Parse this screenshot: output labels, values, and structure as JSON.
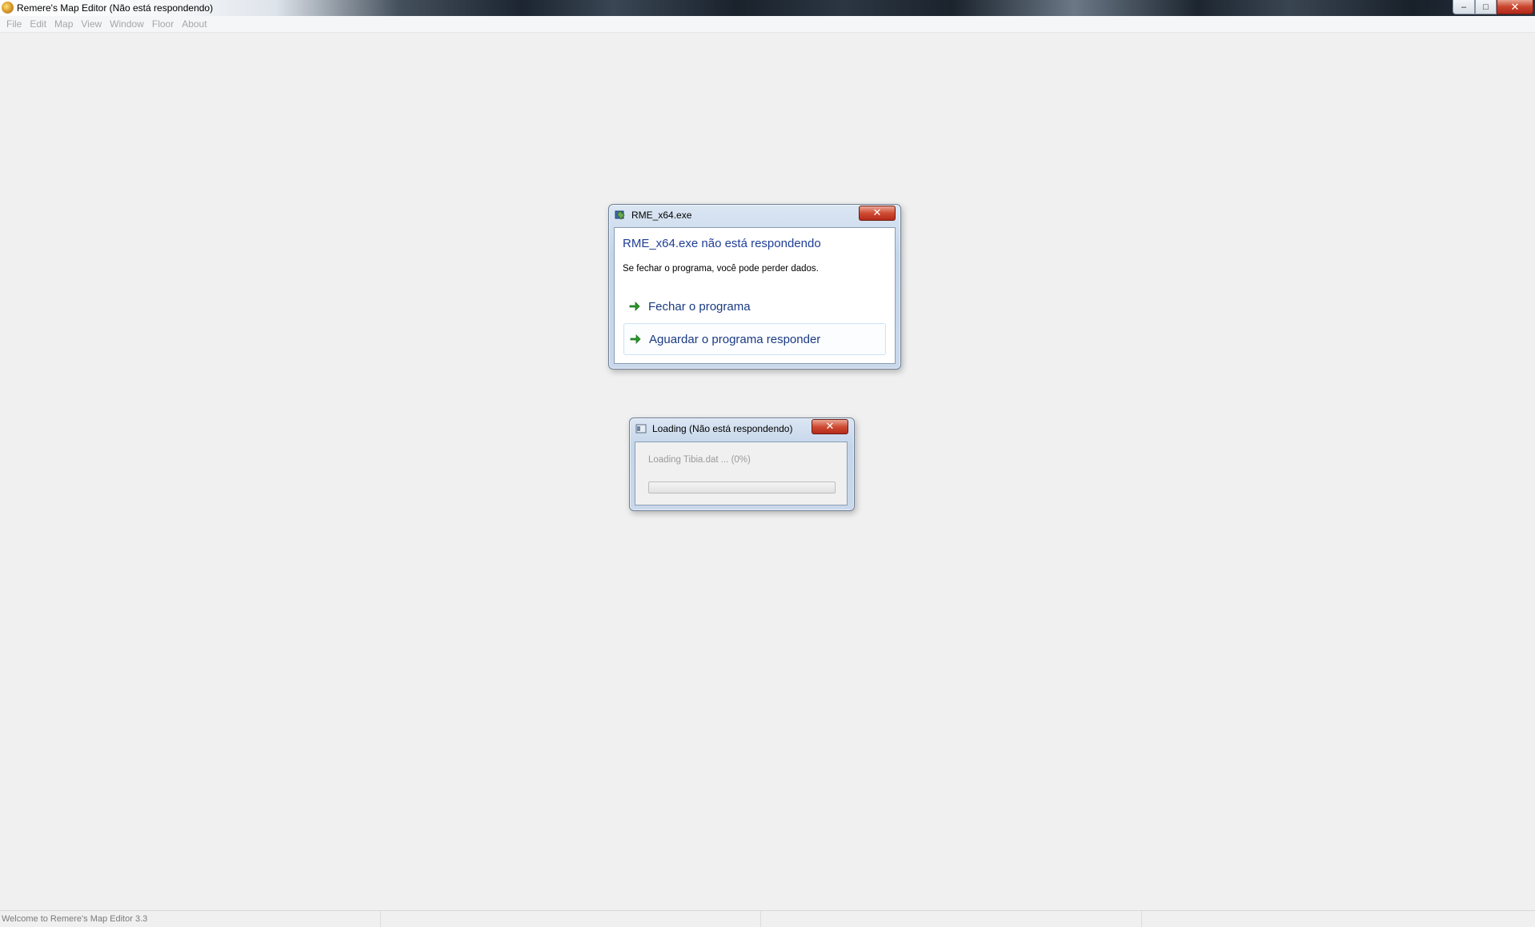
{
  "window": {
    "title": "Remere's Map Editor (Não está respondendo)"
  },
  "menu": [
    "File",
    "Edit",
    "Map",
    "View",
    "Window",
    "Floor",
    "About"
  ],
  "not_responding_dialog": {
    "title": "RME_x64.exe",
    "heading": "RME_x64.exe não está respondendo",
    "message": "Se fechar o programa, você pode perder dados.",
    "options": [
      "Fechar o programa",
      "Aguardar o programa responder"
    ]
  },
  "loading_dialog": {
    "title": "Loading (Não está respondendo)",
    "status": "Loading Tibia.dat ... (0%)",
    "progress": 0
  },
  "statusbar": {
    "panes": [
      "Welcome to Remere's Map Editor 3.3",
      "",
      "",
      ""
    ]
  },
  "colors": {
    "link_blue": "#1f3e96",
    "arrow_green": "#2a9a2a",
    "close_red": "#c8452c"
  },
  "icons": {
    "app": "rme-app-icon",
    "dialog": "program-icon",
    "loading": "window-icon",
    "option": "green-arrow-icon",
    "close": "close-icon"
  }
}
